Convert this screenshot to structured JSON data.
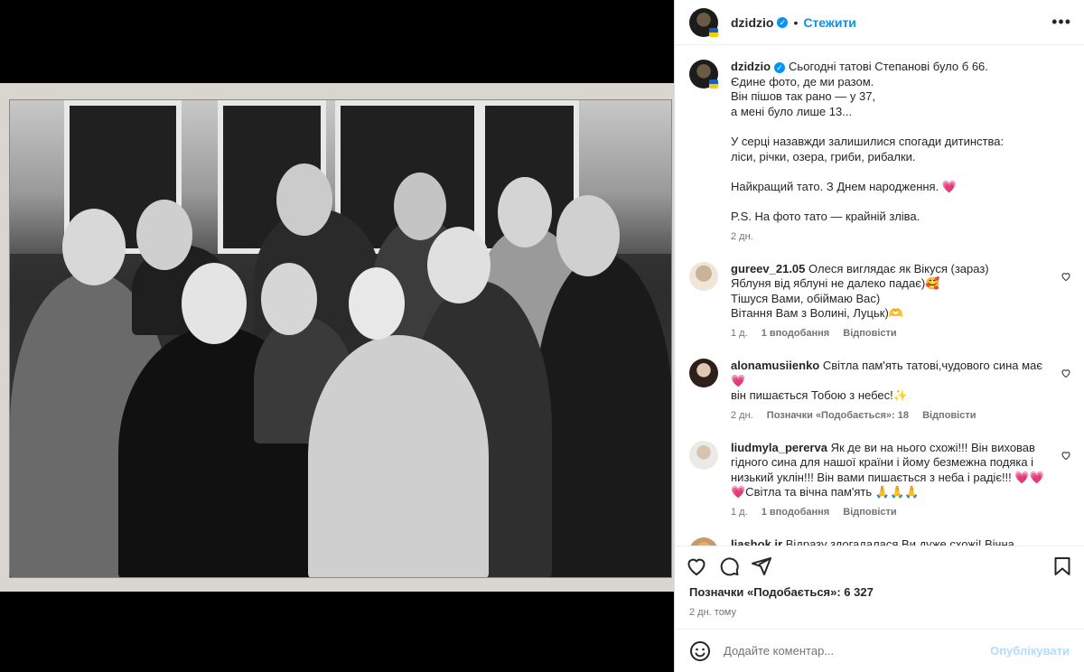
{
  "post": {
    "username": "dzidzio",
    "follow_label": "Стежити",
    "more_label": "•••",
    "caption": "Сьогодні татові Степанові було б 66.\nЄдине фото, де ми разом.\nВін пішов так рано — у 37,\nа мені було лише 13...\n\nУ серці назавжди залишилися спогади дитинства:\nліси, річки, озера, гриби, рибалки.\n\nНайкращий тато. З Днем народження. 💗\n\nP.S. На фото тато — крайній зліва.",
    "caption_time": "2 дн.",
    "likes_text": "Позначки «Подобається»: 6 327",
    "posted_ago": "2 дн. тому",
    "add_comment_placeholder": "Додайте коментар...",
    "publish_label": "Опублікувати"
  },
  "comments": [
    {
      "username": "gureev_21.05",
      "text": "Олеся виглядає як Вікуся (зараз)\nЯблуня від яблуні не далеко падає)🥰\nТішуся Вами, обіймаю Вас)\nВітання Вам з Волині, Луцьк)🫶",
      "time": "1 д.",
      "likes": "1 вподобання",
      "reply": "Відповісти",
      "avatar_color": "#e8dcc8"
    },
    {
      "username": "alonamusiienko",
      "text": "Світла пам'ять татові,чудового сина має💗\nвін пишається Тобою з небес!✨",
      "time": "2 дн.",
      "likes": "Позначки «Подобається»: 18",
      "reply": "Відповісти",
      "avatar_color": "#3a2a24"
    },
    {
      "username": "liudmyla_pererva",
      "text": "Як де ви на нього схожі!!! Він виховав гідного сина для нашої країни і йому безмежна подяка і низький уклін!!! Він вами пишається з неба і радіє!!! 💗💗\n💗Світла та вічна пам'ять 🙏🙏🙏",
      "time": "1 д.",
      "likes": "1 вподобання",
      "reply": "Відповісти",
      "avatar_color": "#cfc6bb"
    },
    {
      "username": "liashok.ir",
      "text": "Відразу здогадалася,Ви дуже схожі! Вічна пам'ять",
      "time": "",
      "likes": "",
      "reply": "",
      "avatar_color": "#d9b78a"
    }
  ],
  "icons": {
    "like": "heart-icon",
    "comment": "comment-icon",
    "share": "share-icon",
    "save": "bookmark-icon",
    "emoji": "emoji-icon",
    "verified": "verified-badge-icon"
  },
  "colors": {
    "accent": "#0095f6",
    "muted": "#737373",
    "publish_disabled": "#b3dbff"
  }
}
